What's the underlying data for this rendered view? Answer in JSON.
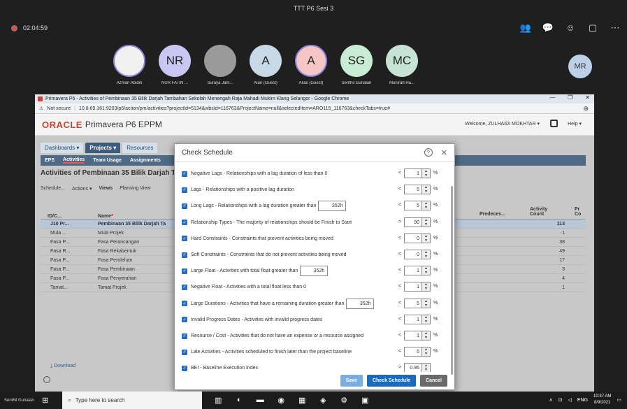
{
  "meeting": {
    "title": "TTT P6 Sesi 3",
    "timer": "02:04:59",
    "participants": [
      {
        "initials": "",
        "name": "Azman Abidin",
        "color": "#f0f0f0"
      },
      {
        "initials": "NR",
        "name": "NUR FATIN ...",
        "color": "#c9c6f4"
      },
      {
        "initials": "",
        "name": "Suraya Jam...",
        "color": "#9a9a9a"
      },
      {
        "initials": "A",
        "name": "Alan (Guest)",
        "color": "#c7d9e6"
      },
      {
        "initials": "A",
        "name": "Alias (Guest)",
        "color": "#f6c6c6"
      },
      {
        "initials": "SG",
        "name": "Senthil Gunalan",
        "color": "#c8ecd6"
      },
      {
        "initials": "MC",
        "name": "Munirah Ha...",
        "color": "#c7e3d6"
      }
    ],
    "self_initials": "MR"
  },
  "browser": {
    "window_title": "Primavera P6 - Activities of Pembinaan 35 Bilik Darjah Tambahan Sekolah Menengah Raja Mahadi Mukim Klang Selangor - Google Chrome",
    "not_secure": "Not secure",
    "url": "10.8.69.161:9203/p6/action/pm/activities?projectId=5134&wbsId=116763&ProjectName=null&selectedItem=ARO115_116763&checkTabs=true#"
  },
  "app": {
    "logo": "ORACLE",
    "product": "Primavera P6 EPPM",
    "welcome": "Welcome, ZULHAIDI MOKHTAR",
    "help": "Help",
    "tabs": [
      "Dashboards",
      "Projects",
      "Resources"
    ],
    "subtabs": [
      "EPS",
      "Activities",
      "Team Usage",
      "Assignments"
    ],
    "project_title": "Activities of Pembinaan 35 Bilik Darjah T",
    "toolbar": [
      "Schedule...",
      "Actions",
      "Views",
      "Planning View"
    ],
    "columns": {
      "id": "ID/C...",
      "name": "Name",
      "predecessors": "Predeces...",
      "activity_count": "Activity Count",
      "pr": "Pr Co"
    },
    "rows": [
      {
        "id": "J10 Pr...",
        "name": "Pembinaan 35 Bilik Darjah Ta",
        "count": "113"
      },
      {
        "id": "Mula ...",
        "name": "Mula Projek",
        "count": "1"
      },
      {
        "id": "Fasa P...",
        "name": "Fasa Perancangan",
        "count": "38"
      },
      {
        "id": "Fasa R...",
        "name": "Fasa Rekabentuk",
        "count": "49"
      },
      {
        "id": "Fasa P...",
        "name": "Fasa Perolehan",
        "count": "17"
      },
      {
        "id": "Fasa P...",
        "name": "Fasa Pembinaan",
        "count": "3"
      },
      {
        "id": "Fasa P...",
        "name": "Fasa Penyerahan",
        "count": "4"
      },
      {
        "id": "Tamat...",
        "name": "Tamat Projek",
        "count": "1"
      }
    ],
    "download": "Download"
  },
  "dialog": {
    "title": "Check Schedule",
    "checks": [
      {
        "label": "Negative Lags - Relationships with a lag duration of less than 0",
        "op": "<",
        "value": "1",
        "unit": "%",
        "hours": ""
      },
      {
        "label": "Lags - Relationships with a positive lag duration",
        "op": "<",
        "value": "5",
        "unit": "%",
        "hours": ""
      },
      {
        "label": "Long Lags - Relationships with a lag duration greater than",
        "op": "<",
        "value": "5",
        "unit": "%",
        "hours": "352h"
      },
      {
        "label": "Relationship Types - The majority of relationships should be Finish to Start",
        "op": ">",
        "value": "90",
        "unit": "%",
        "hours": ""
      },
      {
        "label": "Hard Constraints - Constraints that prevent activities being moved",
        "op": "<",
        "value": "0",
        "unit": "%",
        "hours": ""
      },
      {
        "label": "Soft Constraints - Constraints that do not prevent activities being moved",
        "op": "<",
        "value": "0",
        "unit": "%",
        "hours": ""
      },
      {
        "label": "Large Float - Activities with total float greater than",
        "op": "<",
        "value": "1",
        "unit": "%",
        "hours": "352h"
      },
      {
        "label": "Negative Float - Activities with a total float less than 0",
        "op": "<",
        "value": "1",
        "unit": "%",
        "hours": ""
      },
      {
        "label": "Large Durations - Activities that have a remaining duration greater than",
        "op": "<",
        "value": "5",
        "unit": "%",
        "hours": "352h"
      },
      {
        "label": "Invalid Progress Dates - Activities with invalid progress dates",
        "op": "<",
        "value": "1",
        "unit": "%",
        "hours": ""
      },
      {
        "label": "Resource / Cost - Activities that do not have an expense or a resource assigned",
        "op": "<",
        "value": "1",
        "unit": "%",
        "hours": ""
      },
      {
        "label": "Late Activities - Activities scheduled to finish later than the project baseline",
        "op": "<",
        "value": "5",
        "unit": "%",
        "hours": ""
      },
      {
        "label": "BEI - Baseline Execution Index",
        "op": ">",
        "value": "0.95",
        "unit": "",
        "hours": ""
      }
    ],
    "save": "Save",
    "check_schedule": "Check Schedule",
    "cancel": "Cancel"
  },
  "taskbar": {
    "presenter": "Senthil Gunalan",
    "search_placeholder": "Type here to search",
    "lang": "ENG",
    "time": "10:37 AM",
    "date": "8/9/2021"
  }
}
